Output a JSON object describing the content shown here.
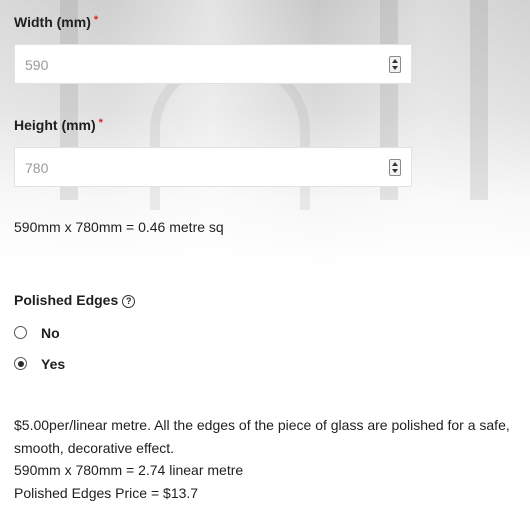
{
  "form": {
    "width_field": {
      "label": "Width (mm)",
      "required_mark": "*",
      "value": "590"
    },
    "height_field": {
      "label": "Height (mm)",
      "required_mark": "*",
      "value": "780"
    },
    "area_summary": "590mm x 780mm = 0.46 metre sq",
    "polished_edges": {
      "label": "Polished Edges",
      "help_icon": "question-circle-icon",
      "options": [
        {
          "label": "No",
          "selected": false
        },
        {
          "label": "Yes",
          "selected": true
        }
      ]
    },
    "description": {
      "rate_text": "$5.00per/linear metre. All the edges of the piece of glass are polished for a safe, smooth, decorative effect.",
      "linear_summary": "590mm x 780mm = 2.74 linear metre",
      "price_text": "Polished Edges Price = $13.7"
    }
  },
  "colors": {
    "required": "#d9252a",
    "text": "#1f1f1f",
    "input_value": "#9a9a9a"
  }
}
